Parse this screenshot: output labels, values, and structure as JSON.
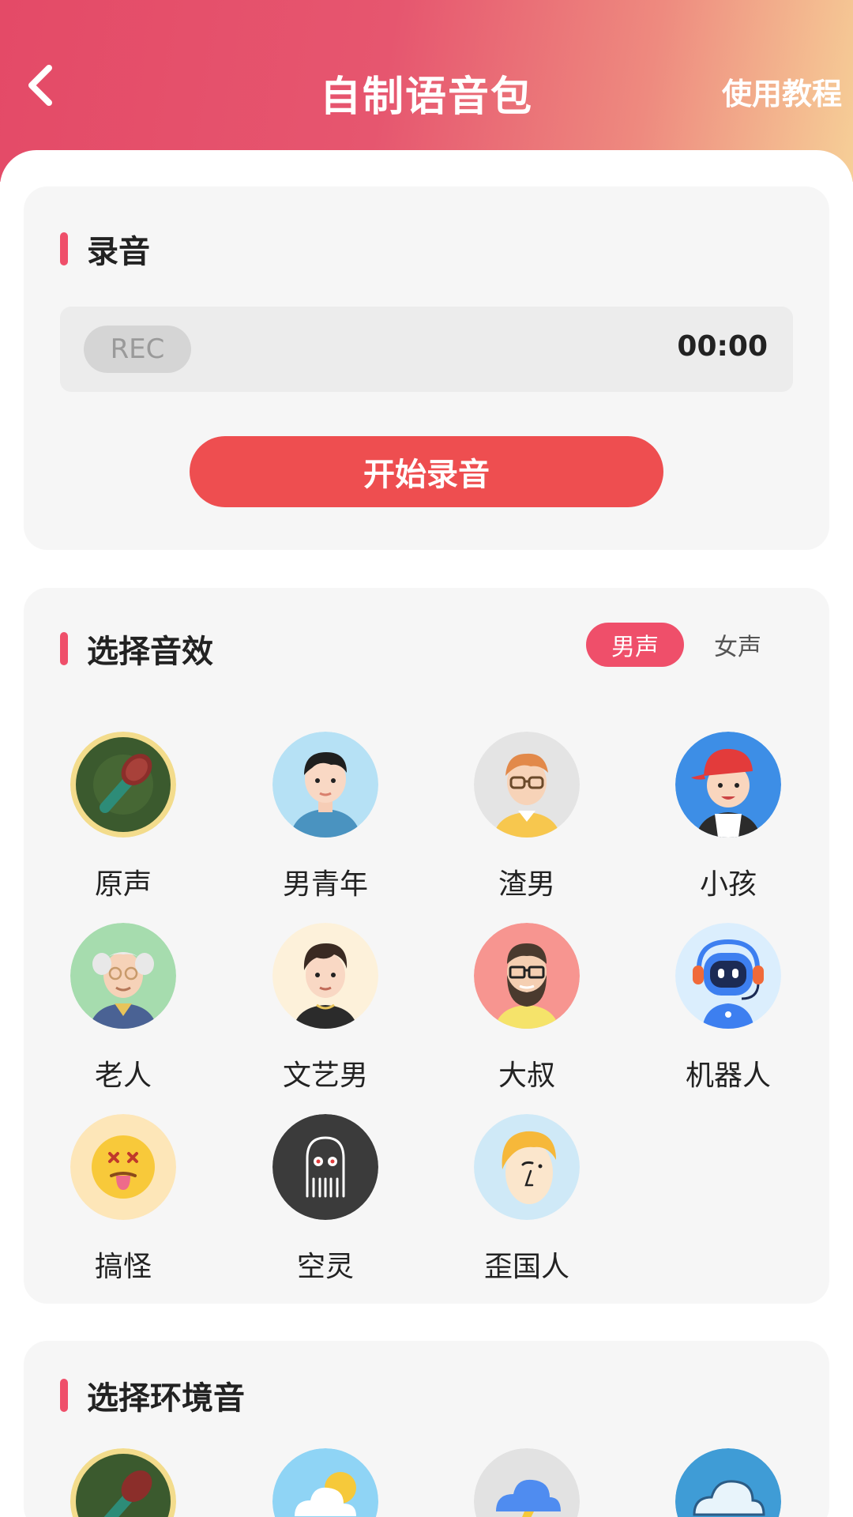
{
  "header": {
    "title": "自制语音包",
    "tutorial": "使用教程"
  },
  "recording": {
    "title": "录音",
    "rec_label": "REC",
    "time": "00:00",
    "start_button": "开始录音"
  },
  "effects": {
    "title": "选择音效",
    "gender_options": [
      "男声",
      "女声"
    ],
    "selected_gender": "男声",
    "items": [
      {
        "label": "原声",
        "icon": "microphone-icon"
      },
      {
        "label": "男青年",
        "icon": "young-man-avatar-icon"
      },
      {
        "label": "渣男",
        "icon": "glasses-man-avatar-icon"
      },
      {
        "label": "小孩",
        "icon": "child-cap-avatar-icon"
      },
      {
        "label": "老人",
        "icon": "old-man-avatar-icon"
      },
      {
        "label": "文艺男",
        "icon": "artsy-man-avatar-icon"
      },
      {
        "label": "大叔",
        "icon": "bearded-man-avatar-icon"
      },
      {
        "label": "机器人",
        "icon": "robot-avatar-icon"
      },
      {
        "label": "搞怪",
        "icon": "silly-face-icon"
      },
      {
        "label": "空灵",
        "icon": "ghost-icon"
      },
      {
        "label": "歪国人",
        "icon": "foreigner-avatar-icon"
      }
    ]
  },
  "environment": {
    "title": "选择环境音",
    "icons": [
      "microphone-icon",
      "sunny-cloud-icon",
      "thunderstorm-icon",
      "wind-cloud-icon"
    ]
  },
  "colors": {
    "accent": "#ef4f6a",
    "start_button": "#ee4e50",
    "header_gradient": [
      "#e44a67",
      "#f6cf97"
    ]
  }
}
